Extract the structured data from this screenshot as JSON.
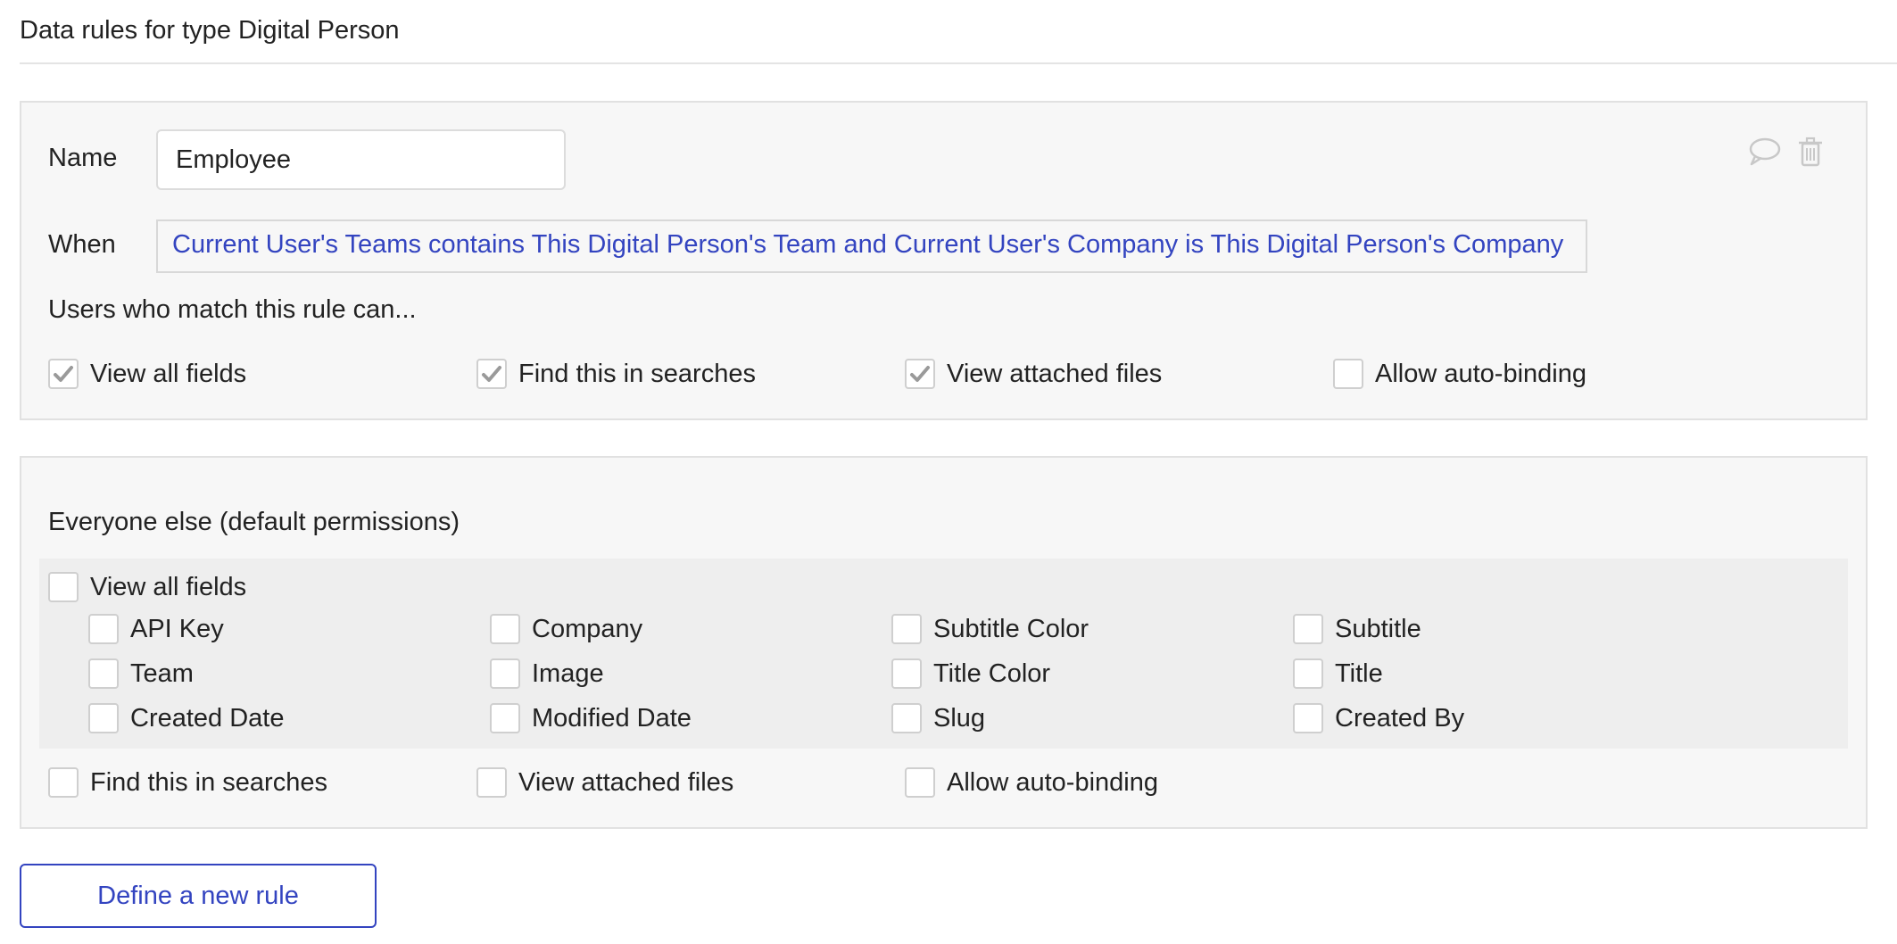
{
  "page": {
    "title": "Data rules for type Digital Person"
  },
  "rule": {
    "name_label": "Name",
    "name_value": "Employee",
    "when_label": "When",
    "when_expression": "Current User's Teams contains This Digital Person's Team and Current User's Company is This Digital Person's Company",
    "users_caption": "Users who match this rule can...",
    "permissions": [
      {
        "label": "View all fields",
        "checked": true
      },
      {
        "label": "Find this in searches",
        "checked": true
      },
      {
        "label": "View attached files",
        "checked": true
      },
      {
        "label": "Allow auto-binding",
        "checked": false
      }
    ],
    "icons": [
      "comment-icon",
      "trash-icon"
    ]
  },
  "default": {
    "heading": "Everyone else (default permissions)",
    "view_all_fields": {
      "label": "View all fields",
      "checked": false
    },
    "fields": [
      {
        "label": "API Key",
        "checked": false
      },
      {
        "label": "Company",
        "checked": false
      },
      {
        "label": "Subtitle Color",
        "checked": false
      },
      {
        "label": "Subtitle",
        "checked": false
      },
      {
        "label": "Team",
        "checked": false
      },
      {
        "label": "Image",
        "checked": false
      },
      {
        "label": "Title Color",
        "checked": false
      },
      {
        "label": "Title",
        "checked": false
      },
      {
        "label": "Created Date",
        "checked": false
      },
      {
        "label": "Modified Date",
        "checked": false
      },
      {
        "label": "Slug",
        "checked": false
      },
      {
        "label": "Created By",
        "checked": false
      }
    ],
    "permissions": [
      {
        "label": "Find this in searches",
        "checked": false
      },
      {
        "label": "View attached files",
        "checked": false
      },
      {
        "label": "Allow auto-binding",
        "checked": false
      }
    ]
  },
  "actions": {
    "new_rule_label": "Define a new rule"
  },
  "colors": {
    "link": "#3344c0",
    "check": "#9a9a9a",
    "panel_bg": "#f7f7f7",
    "band_bg": "#eeeeee"
  }
}
